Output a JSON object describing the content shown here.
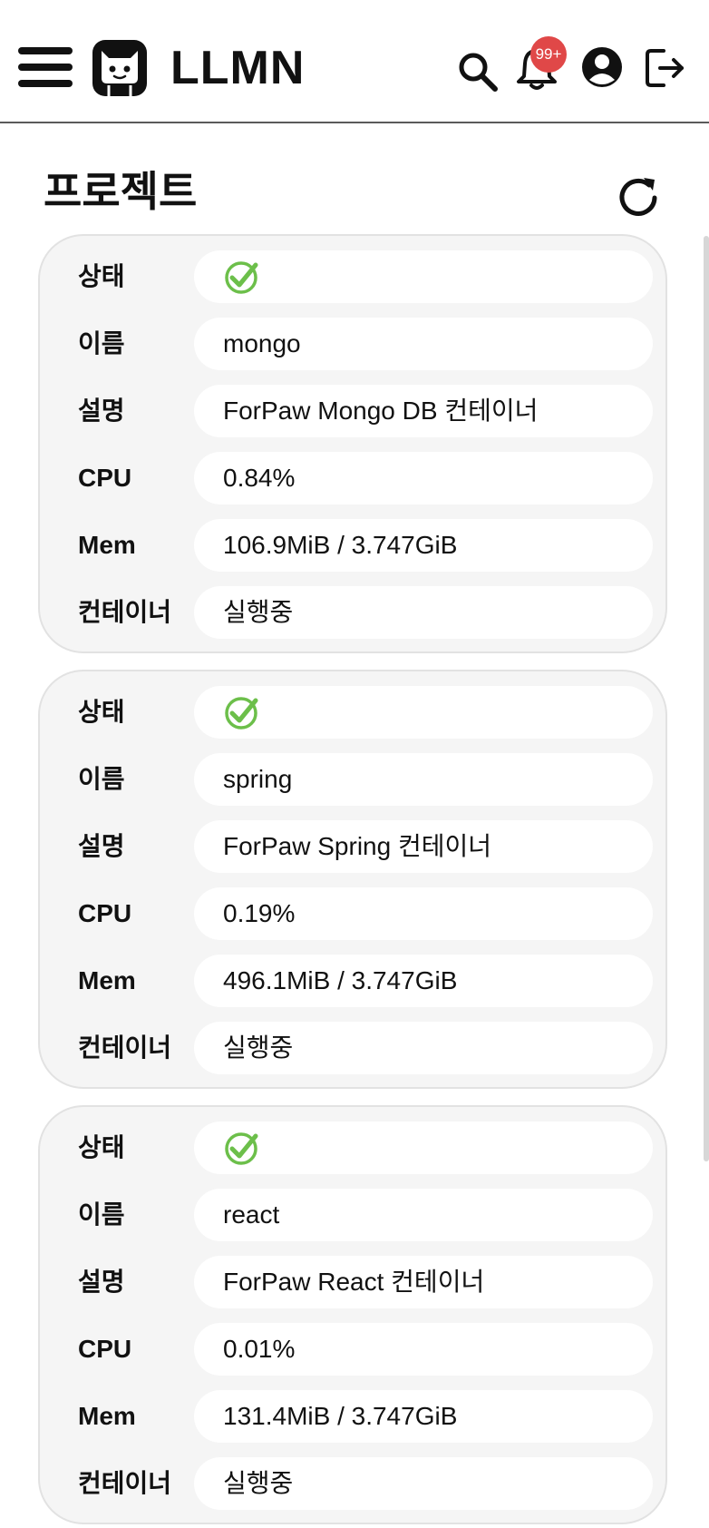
{
  "header": {
    "app_title": "LLMN",
    "notification_badge": "99+",
    "icons": [
      "hamburger-menu-icon",
      "cat-logo-icon",
      "search-icon",
      "bell-icon",
      "user-icon",
      "logout-icon"
    ]
  },
  "page": {
    "title": "프로젝트",
    "refresh_icon": "refresh-icon"
  },
  "colors": {
    "status_ok": "#6cbf4a",
    "badge": "#e04848",
    "card_bg": "#f5f5f5"
  },
  "labels": {
    "status": "상태",
    "name": "이름",
    "description": "설명",
    "cpu": "CPU",
    "mem": "Mem",
    "container": "컨테이너"
  },
  "projects": [
    {
      "status_icon": "check-circle-icon",
      "name": "mongo",
      "description": "ForPaw Mongo DB 컨테이너",
      "cpu": "0.84%",
      "mem": "106.9MiB / 3.747GiB",
      "container": "실행중"
    },
    {
      "status_icon": "check-circle-icon",
      "name": "spring",
      "description": "ForPaw Spring 컨테이너",
      "cpu": "0.19%",
      "mem": "496.1MiB / 3.747GiB",
      "container": "실행중"
    },
    {
      "status_icon": "check-circle-icon",
      "name": "react",
      "description": "ForPaw React 컨테이너",
      "cpu": "0.01%",
      "mem": "131.4MiB / 3.747GiB",
      "container": "실행중"
    }
  ]
}
